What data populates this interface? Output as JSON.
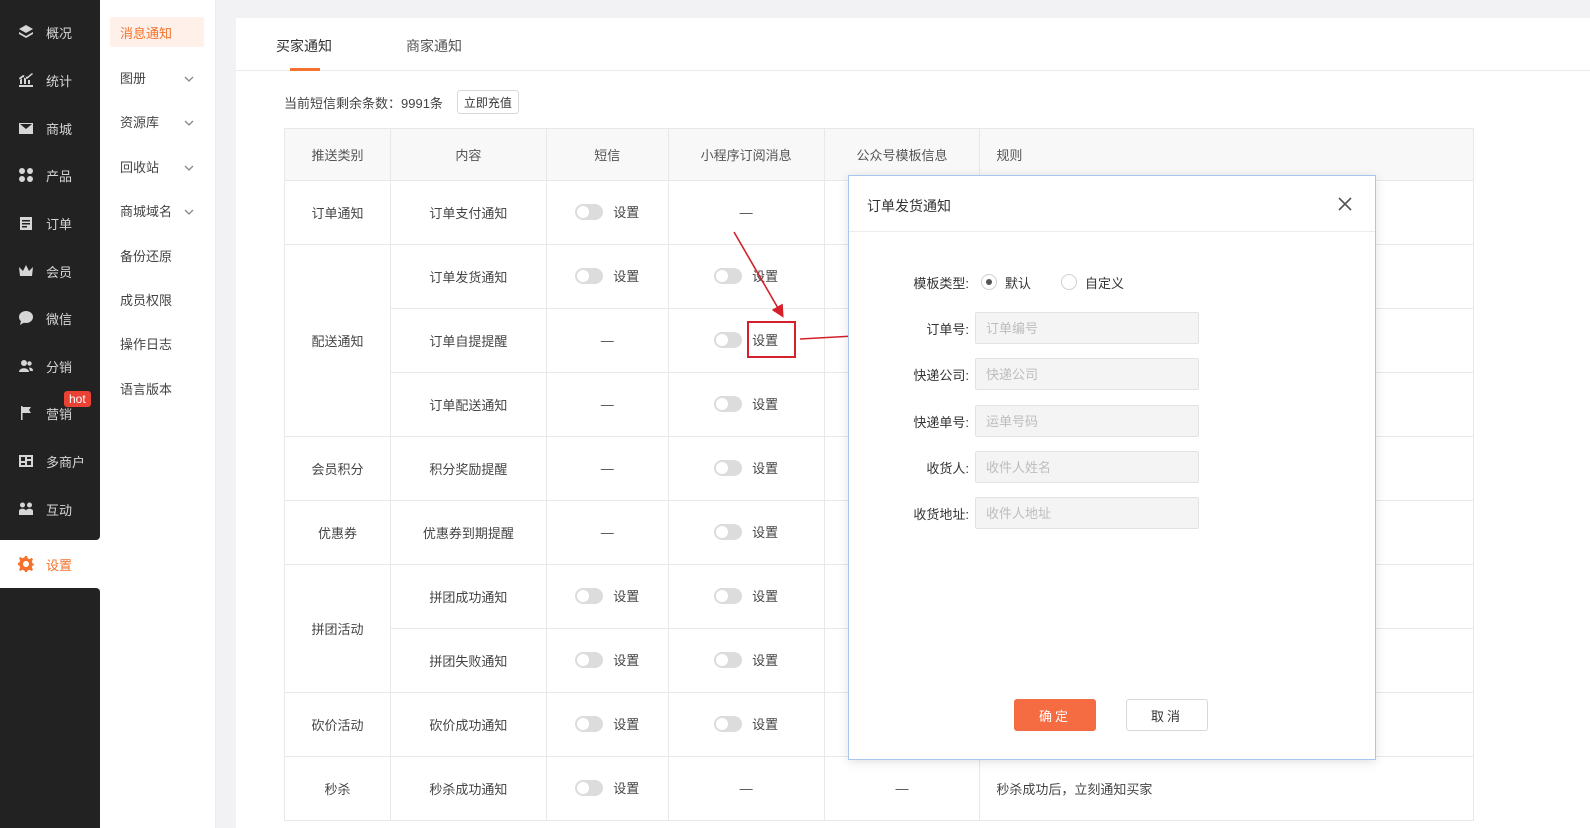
{
  "nav": {
    "items": [
      {
        "label": "概况",
        "icon": "layers-icon"
      },
      {
        "label": "统计",
        "icon": "chart-icon"
      },
      {
        "label": "商城",
        "icon": "mail-icon"
      },
      {
        "label": "产品",
        "icon": "grid-icon"
      },
      {
        "label": "订单",
        "icon": "order-icon"
      },
      {
        "label": "会员",
        "icon": "crown-icon"
      },
      {
        "label": "微信",
        "icon": "chat-icon"
      },
      {
        "label": "分销",
        "icon": "users-icon"
      },
      {
        "label": "营销",
        "icon": "flag-icon"
      },
      {
        "label": "多商户",
        "icon": "store-icon"
      },
      {
        "label": "互动",
        "icon": "group-icon"
      },
      {
        "label": "设置",
        "icon": "gear-icon"
      }
    ],
    "hot_badge": "hot",
    "active_color": "#f4722b"
  },
  "subnav": {
    "items": [
      {
        "label": "消息通知"
      },
      {
        "label": "图册"
      },
      {
        "label": "资源库"
      },
      {
        "label": "回收站"
      },
      {
        "label": "商城域名"
      },
      {
        "label": "备份还原"
      },
      {
        "label": "成员权限"
      },
      {
        "label": "操作日志"
      },
      {
        "label": "语言版本"
      }
    ]
  },
  "tabs": [
    "买家通知",
    "商家通知"
  ],
  "sms": {
    "remaining_text": "当前短信剩余条数：9991条",
    "recharge_label": "立即充值"
  },
  "table": {
    "headers": [
      "推送类别",
      "内容",
      "短信",
      "小程序订阅消息",
      "公众号模板信息",
      "规则"
    ],
    "setting_label": "设置",
    "dash": "—",
    "categories": [
      "订单通知",
      "配送通知",
      "会员积分",
      "优惠券",
      "拼团活动",
      "砍价活动",
      "秒杀"
    ],
    "rows": [
      {
        "content": "订单支付通知",
        "rule": ""
      },
      {
        "content": "订单发货通知",
        "rule": ""
      },
      {
        "content": "订单自提提醒",
        "rule": ""
      },
      {
        "content": "订单配送通知",
        "rule": ""
      },
      {
        "content": "积分奖励提醒",
        "rule": ""
      },
      {
        "content": "优惠券到期提醒",
        "rule": ""
      },
      {
        "content": "拼团成功通知",
        "rule": ""
      },
      {
        "content": "拼团失败通知",
        "rule": ""
      },
      {
        "content": "砍价成功通知",
        "rule": ""
      },
      {
        "content": "秒杀成功通知",
        "rule": "秒杀成功后，立刻通知买家"
      }
    ]
  },
  "modal": {
    "title": "订单发货通知",
    "template_type_label": "模板类型:",
    "radio_default": "默认",
    "radio_custom": "自定义",
    "fields": [
      {
        "label": "订单号:",
        "placeholder": "订单编号"
      },
      {
        "label": "快递公司:",
        "placeholder": "快递公司"
      },
      {
        "label": "快递单号:",
        "placeholder": "运单号码"
      },
      {
        "label": "收货人:",
        "placeholder": "收件人姓名"
      },
      {
        "label": "收货地址:",
        "placeholder": "收件人地址"
      }
    ],
    "ok_label": "确定",
    "cancel_label": "取消",
    "ok_color": "#f56b42"
  },
  "annotation_color": "#d4202a"
}
